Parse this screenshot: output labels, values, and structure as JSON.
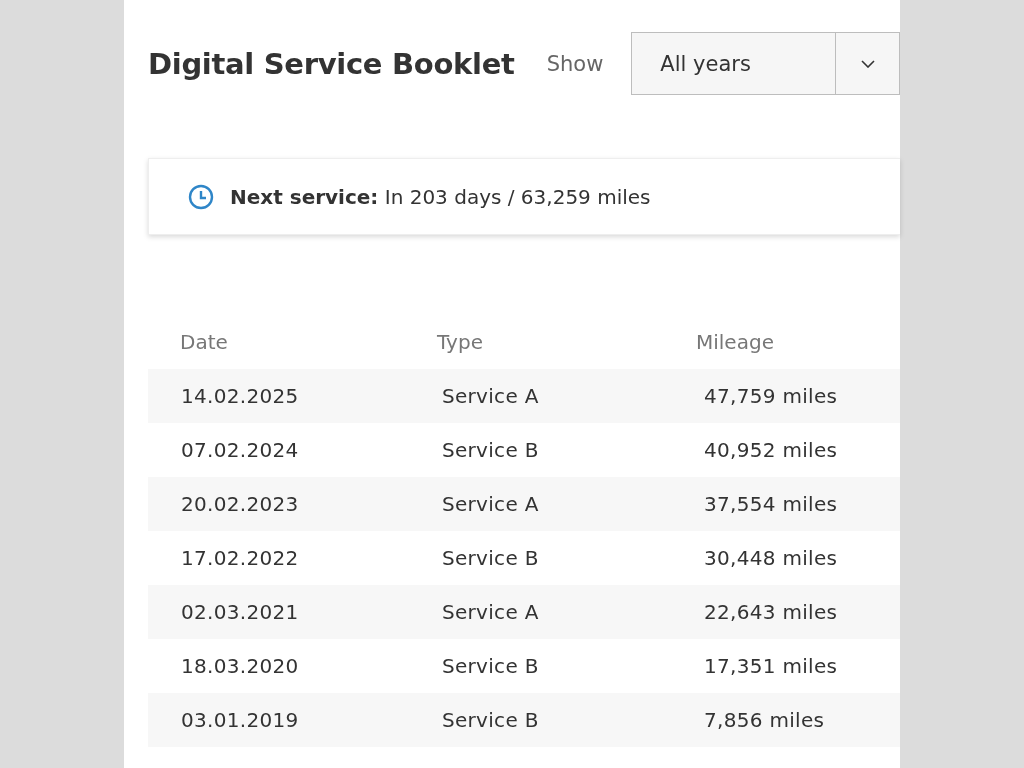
{
  "header": {
    "title": "Digital Service Booklet",
    "filter_label": "Show",
    "filter_value": "All years"
  },
  "next_service": {
    "text": "**Next service:** In 203 days / 63,259 miles"
  },
  "table": {
    "columns": [
      "Date",
      "Type",
      "Mileage"
    ],
    "rows": [
      [
        "14.02.2025",
        "Service A",
        "47,759 miles"
      ],
      [
        "07.02.2024",
        "Service B",
        "40,952 miles"
      ],
      [
        "20.02.2023",
        "Service A",
        "37,554 miles"
      ],
      [
        "17.02.2022",
        "Service B",
        "30,448 miles"
      ],
      [
        "02.03.2021",
        "Service A",
        "22,643 miles"
      ],
      [
        "18.03.2020",
        "Service B",
        "17,351 miles"
      ],
      [
        "03.01.2019",
        "Service B",
        "7,856 miles"
      ]
    ]
  }
}
